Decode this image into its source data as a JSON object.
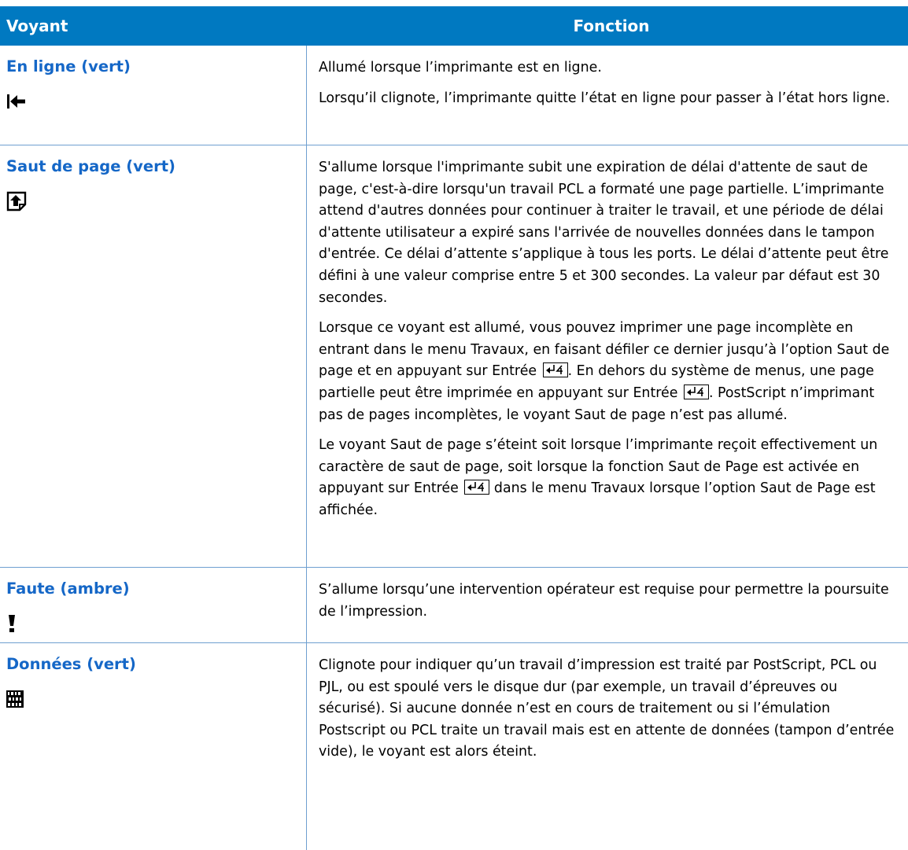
{
  "header": {
    "col1": "Voyant",
    "col2": "Fonction"
  },
  "rows": [
    {
      "label": "En ligne (vert)",
      "icon": "online-arrow-icon",
      "p": [
        "Allumé lorsque l’imprimante est en ligne.",
        "Lorsqu’il clignote, l’imprimante quitte l’état en ligne pour passer à l’état hors ligne."
      ]
    },
    {
      "label": "Saut de page (vert)",
      "icon": "form-feed-icon",
      "p": [
        "S'allume lorsque l'imprimante subit une expiration de délai d'attente de saut de page, c'est-à-dire lorsqu'un travail PCL a formaté une page partielle. L’imprimante attend d'autres données pour continuer à traiter le travail, et une période de délai d'attente utilisateur a expiré sans l'arrivée de nouvelles données dans le tampon d'entrée. Ce délai d’attente s’applique à tous les ports. Le délai d’attente peut être défini à une valeur comprise entre 5 et 300 secondes. La valeur par défaut est 30 secondes.",
        "Lorsque ce voyant est allumé, vous pouvez imprimer une page incomplète en entrant dans le menu Travaux, en faisant défiler ce dernier jusqu’à l’option Saut de page et en appuyant sur Entrée",
        ". En dehors du système de menus, une page partielle peut être imprimée en appuyant sur Entrée",
        ". PostScript n’imprimant pas de pages incomplètes, le voyant Saut de page n’est pas allumé.",
        "Le voyant Saut de page s’éteint soit lorsque l’imprimante reçoit effectivement un caractère de saut de page, soit lorsque la fonction Saut de Page est activée en appuyant sur Entrée",
        " dans le menu Travaux lorsque l’option Saut de Page est affichée."
      ]
    },
    {
      "label": "Faute (ambre)",
      "icon": "exclamation-icon",
      "p": [
        "S’allume lorsqu’une intervention opérateur est requise pour permettre la poursuite de l’impression."
      ]
    },
    {
      "label": "Données (vert)",
      "icon": "data-binary-icon",
      "p": [
        "Clignote pour indiquer qu’un travail d’impression est traité par PostScript, PCL ou PJL, ou est spoulé vers le disque dur (par exemple, un travail d’épreuves ou sécurisé). Si aucune donnée n’est en cours de traitement ou si l’émulation Postscript ou PCL traite un travail mais est en attente de données (tampon d’entrée vide), le voyant est alors éteint."
      ]
    }
  ]
}
